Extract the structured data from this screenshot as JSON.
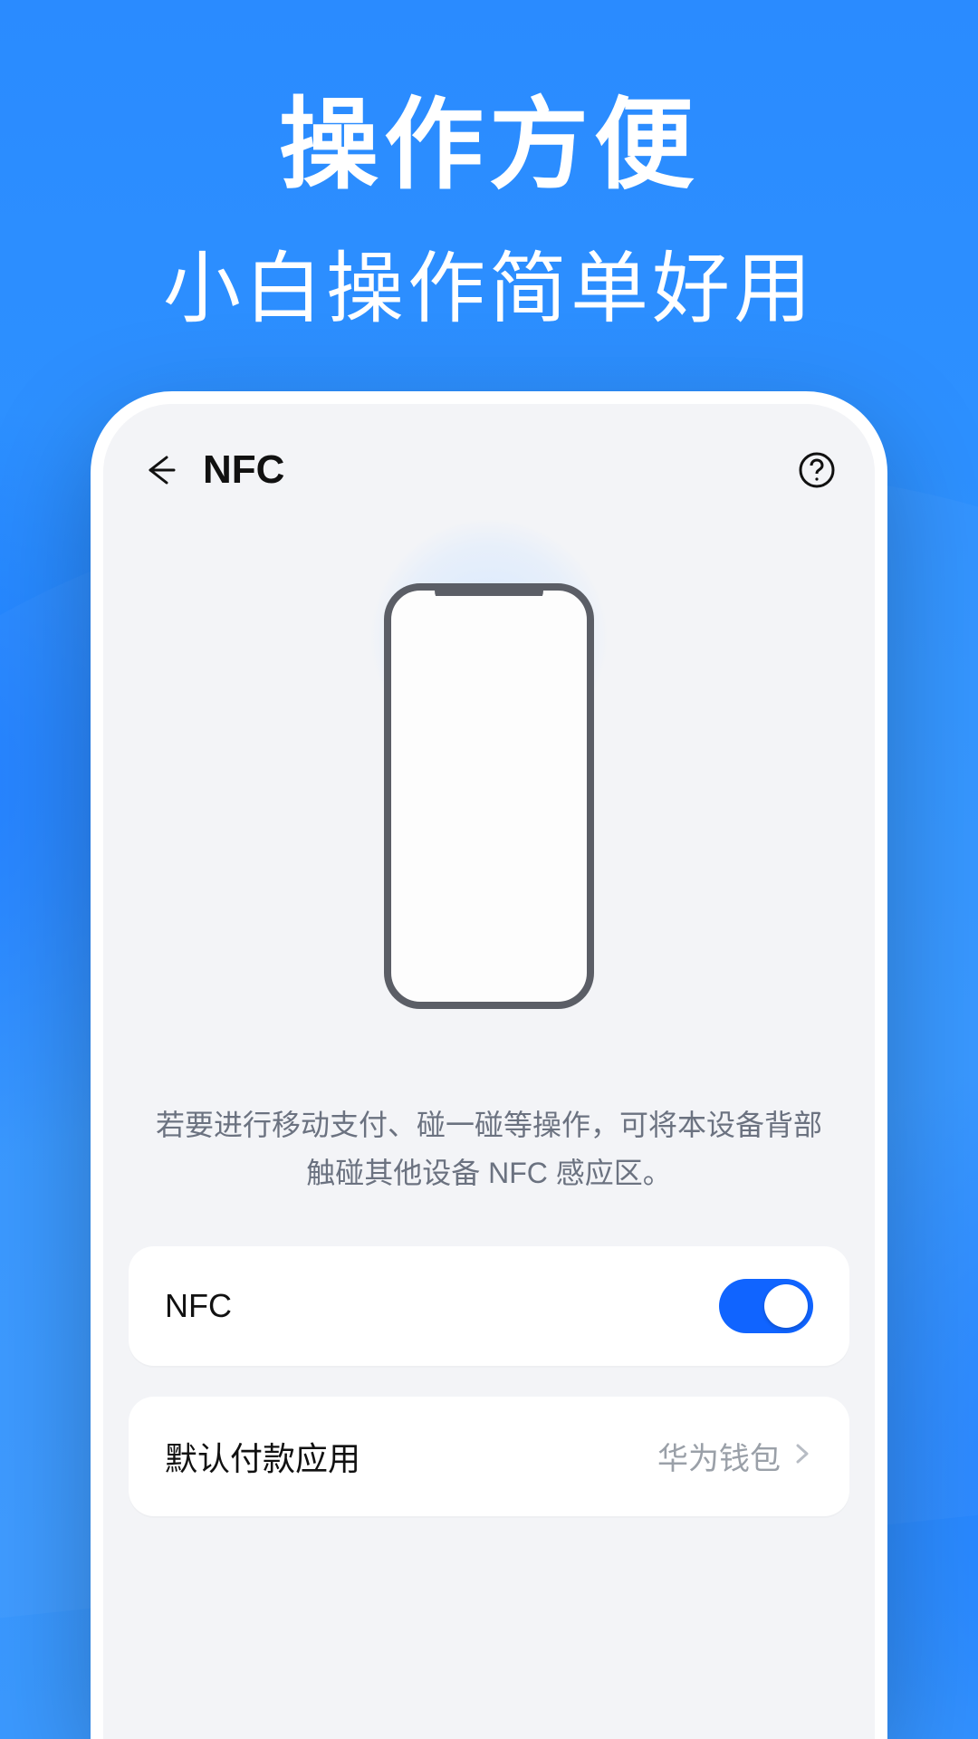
{
  "promo": {
    "heading": "操作方便",
    "subheading": "小白操作简单好用"
  },
  "header": {
    "title": "NFC"
  },
  "description": "若要进行移动支付、碰一碰等操作，可将本设备背部触碰其他设备 NFC 感应区。",
  "settings": {
    "nfc_toggle": {
      "label": "NFC",
      "enabled": true
    },
    "default_app": {
      "label": "默认付款应用",
      "value": "华为钱包"
    }
  }
}
